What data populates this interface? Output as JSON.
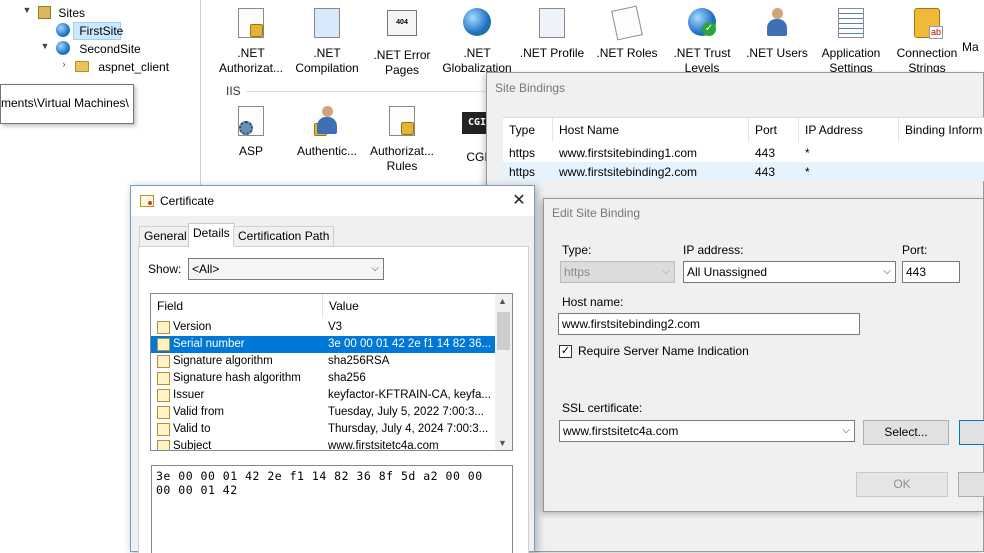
{
  "tree": {
    "items": [
      {
        "label": "Sites",
        "icon": "sites-folder-icon",
        "expand": "chevron-down"
      },
      {
        "label": "FirstSite",
        "icon": "globe-icon",
        "selected": true
      },
      {
        "label": "SecondSite",
        "icon": "globe-icon",
        "expand": "chevron-down"
      },
      {
        "label": "aspnet_client",
        "icon": "folder-icon",
        "expand": "chevron-right"
      }
    ],
    "tooltip": "ments\\Virtual Machines\\"
  },
  "features": {
    "section_label": "IIS",
    "row1": [
      {
        "label1": ".NET",
        "label2": "Authorizat...",
        "icon": "net-authorization-icon"
      },
      {
        "label1": ".NET",
        "label2": "Compilation",
        "icon": "net-compilation-icon"
      },
      {
        "label1": ".NET Error",
        "label2": "Pages",
        "icon": "net-error-pages-icon",
        "badge": "404"
      },
      {
        "label1": ".NET",
        "label2": "Globalization",
        "icon": "net-globalization-icon"
      },
      {
        "label1": ".NET Profile",
        "label2": "",
        "icon": "net-profile-icon"
      },
      {
        "label1": ".NET Roles",
        "label2": "",
        "icon": "net-roles-icon"
      },
      {
        "label1": ".NET Trust",
        "label2": "Levels",
        "icon": "net-trust-levels-icon"
      },
      {
        "label1": ".NET Users",
        "label2": "",
        "icon": "net-users-icon"
      },
      {
        "label1": "Application",
        "label2": "Settings",
        "icon": "application-settings-icon"
      },
      {
        "label1": "Connection",
        "label2": "Strings",
        "icon": "connection-strings-icon",
        "badge": "ab"
      },
      {
        "label1": "Ma",
        "label2": "",
        "icon": "machine-key-icon"
      }
    ],
    "row2": [
      {
        "label1": "ASP",
        "label2": "",
        "icon": "asp-icon"
      },
      {
        "label1": "Authentic...",
        "label2": "",
        "icon": "authentication-icon"
      },
      {
        "label1": "Authorizat...",
        "label2": "Rules",
        "icon": "authorization-rules-icon"
      },
      {
        "label1": "CGI",
        "label2": "",
        "icon": "cgi-icon",
        "badge": "CGI"
      }
    ]
  },
  "site_bindings": {
    "title": "Site Bindings",
    "columns": [
      "Type",
      "Host Name",
      "Port",
      "IP Address",
      "Binding Inform"
    ],
    "rows": [
      {
        "type": "https",
        "host": "www.firstsitebinding1.com",
        "port": "443",
        "ip": "*"
      },
      {
        "type": "https",
        "host": "www.firstsitebinding2.com",
        "port": "443",
        "ip": "*"
      }
    ]
  },
  "edit_binding": {
    "title": "Edit Site Binding",
    "type_label": "Type:",
    "type_value": "https",
    "ip_label": "IP address:",
    "ip_value": "All Unassigned",
    "port_label": "Port:",
    "port_value": "443",
    "host_label": "Host name:",
    "host_value": "www.firstsitebinding2.com",
    "sni_label": "Require Server Name Indication",
    "sni_checked": "✓",
    "ssl_label": "SSL certificate:",
    "ssl_value": "www.firstsitetc4a.com",
    "select_button": "Select...",
    "ok_button": "OK"
  },
  "certificate": {
    "title": "Certificate",
    "close_glyph": "✕",
    "tabs": [
      "General",
      "Details",
      "Certification Path"
    ],
    "active_tab": "Details",
    "show_label": "Show:",
    "show_value": "<All>",
    "columns": [
      "Field",
      "Value"
    ],
    "fields": [
      {
        "field": "Version",
        "value": "V3"
      },
      {
        "field": "Serial number",
        "value": "3e 00 00 01 42 2e f1 14 82 36...",
        "selected": true
      },
      {
        "field": "Signature algorithm",
        "value": "sha256RSA"
      },
      {
        "field": "Signature hash algorithm",
        "value": "sha256"
      },
      {
        "field": "Issuer",
        "value": "keyfactor-KFTRAIN-CA, keyfa..."
      },
      {
        "field": "Valid from",
        "value": "Tuesday, July 5, 2022 7:00:3..."
      },
      {
        "field": "Valid to",
        "value": "Thursday, July 4, 2024 7:00:3..."
      },
      {
        "field": "Subject",
        "value": "www.firstsitetc4a.com"
      }
    ],
    "detail_value": "3e 00 00 01 42 2e f1 14 82 36 8f 5d a2 00 00\n00 00 01 42"
  },
  "colors": {
    "selection": "#0078d7",
    "tree_selection": "#cce8ff",
    "dialog_bg": "#f0f0f0"
  }
}
